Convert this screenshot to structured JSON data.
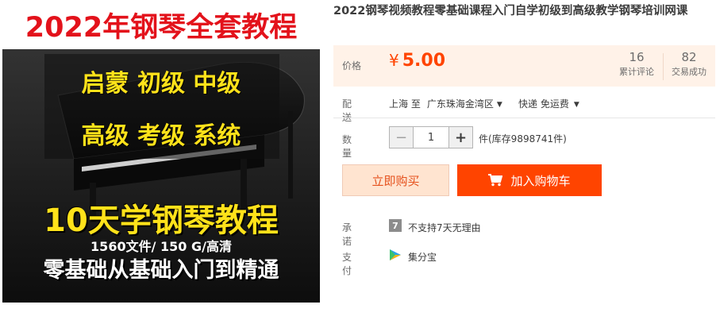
{
  "image": {
    "title": "2022年钢琴全套教程",
    "row1": "启蒙  初级  中级",
    "row2": "高级  考级  系统",
    "headline": "10天学钢琴教程",
    "files": "1560文件/ 150 G/高清",
    "bottom": "零基础从基础入门到精通"
  },
  "product": {
    "title": "2022钢琴视频教程零基础课程入门自学初级到高级教学钢琴培训网课"
  },
  "price": {
    "label": "价格",
    "currency": "¥",
    "value": "5.00",
    "reviews_count": "16",
    "reviews_label": "累计评论",
    "deals_count": "82",
    "deals_label": "交易成功"
  },
  "shipping": {
    "label": "配送",
    "origin": "上海 至",
    "destination": "广东珠海金湾区",
    "method": "快递 免运费"
  },
  "quantity": {
    "label": "数量",
    "value": "1",
    "minus": "−",
    "plus": "+",
    "stock": "件(库存9898741件)"
  },
  "actions": {
    "buy_now": "立即购买",
    "add_to_cart": "加入购物车"
  },
  "promise": {
    "label": "承诺",
    "badge": "7",
    "text": "不支持7天无理由"
  },
  "payment": {
    "label": "支付",
    "text": "集分宝"
  },
  "colors": {
    "accent": "#ff4400",
    "price_bg": "#fff2e8",
    "buy_bg": "#ffe4d0"
  },
  "icons": {
    "cart": "shopping-cart-icon",
    "payment": "jifenbao-icon",
    "dropdown": "caret-down-icon"
  }
}
